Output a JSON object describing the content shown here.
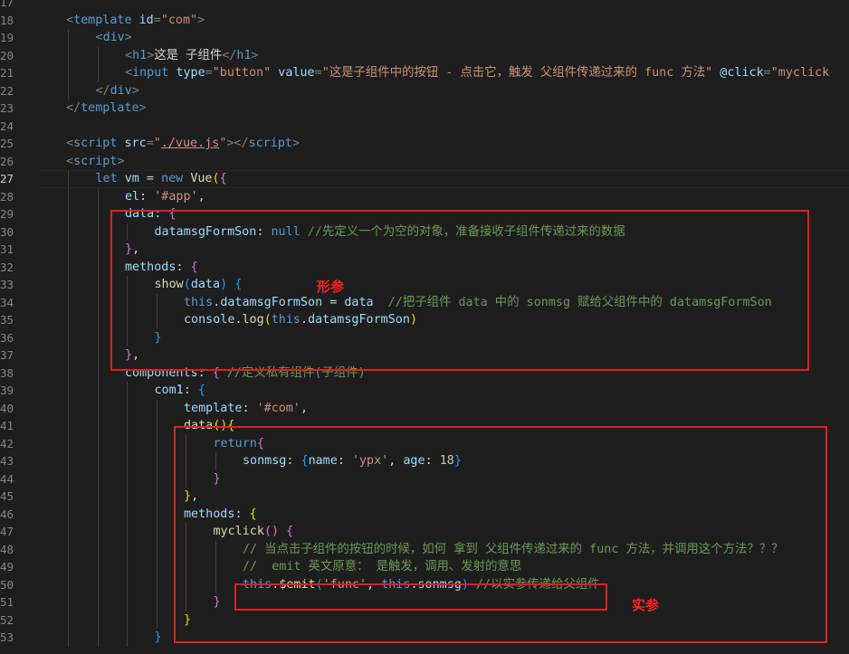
{
  "editor": {
    "colors": {
      "background": "#1e1e1e",
      "tag": "#569cd6",
      "attr": "#9cdcfe",
      "string": "#ce9178",
      "keyword": "#c586c0",
      "function": "#dcdcaa",
      "comment": "#6a9955",
      "text": "#d4d4d4",
      "annotation": "#e0201f"
    },
    "active_line": 27,
    "lines": [
      {
        "n": 17,
        "i": 0,
        "t": []
      },
      {
        "n": 18,
        "i": 1,
        "t": [
          [
            "p",
            "<"
          ],
          [
            "tg",
            "template"
          ],
          [
            "a",
            " id"
          ],
          [
            "p",
            "="
          ],
          [
            "s",
            "\"com\""
          ],
          [
            "p",
            ">"
          ]
        ]
      },
      {
        "n": 19,
        "i": 2,
        "t": [
          [
            "p",
            "<"
          ],
          [
            "tg",
            "div"
          ],
          [
            "p",
            ">"
          ]
        ]
      },
      {
        "n": 20,
        "i": 3,
        "t": [
          [
            "p",
            "<"
          ],
          [
            "tg",
            "h1"
          ],
          [
            "p",
            ">"
          ],
          [
            "tx",
            "这是 子组件"
          ],
          [
            "p",
            "</"
          ],
          [
            "tg",
            "h1"
          ],
          [
            "p",
            ">"
          ]
        ]
      },
      {
        "n": 21,
        "i": 3,
        "t": [
          [
            "p",
            "<"
          ],
          [
            "tg",
            "input"
          ],
          [
            "a",
            " type"
          ],
          [
            "p",
            "="
          ],
          [
            "s",
            "\"button\""
          ],
          [
            "a",
            " value"
          ],
          [
            "p",
            "="
          ],
          [
            "s",
            "\"这是子组件中的按钮 - 点击它，触发 父组件传递过来的 func 方法\""
          ],
          [
            "a",
            " @click"
          ],
          [
            "p",
            "="
          ],
          [
            "s",
            "\"myclick"
          ]
        ]
      },
      {
        "n": 22,
        "i": 2,
        "t": [
          [
            "p",
            "</"
          ],
          [
            "tg",
            "div"
          ],
          [
            "p",
            ">"
          ]
        ]
      },
      {
        "n": 23,
        "i": 1,
        "t": [
          [
            "p",
            "</"
          ],
          [
            "tg",
            "template"
          ],
          [
            "p",
            ">"
          ]
        ]
      },
      {
        "n": 24,
        "i": 0,
        "t": []
      },
      {
        "n": 25,
        "i": 1,
        "t": [
          [
            "p",
            "<"
          ],
          [
            "tg",
            "script"
          ],
          [
            "a",
            " src"
          ],
          [
            "p",
            "="
          ],
          [
            "s",
            "\""
          ],
          [
            "su",
            "./vue.js"
          ],
          [
            "s",
            "\""
          ],
          [
            "p",
            "></"
          ],
          [
            "tg",
            "script"
          ],
          [
            "p",
            ">"
          ]
        ]
      },
      {
        "n": 26,
        "i": 1,
        "t": [
          [
            "p",
            "<"
          ],
          [
            "tg",
            "script"
          ],
          [
            "p",
            ">"
          ]
        ]
      },
      {
        "n": 27,
        "i": 2,
        "t": [
          [
            "k",
            "let"
          ],
          [
            "tx",
            " "
          ],
          [
            "v",
            "vm"
          ],
          [
            "tx",
            " = "
          ],
          [
            "k",
            "new"
          ],
          [
            "tx",
            " "
          ],
          [
            "f",
            "Vue"
          ],
          [
            "b1",
            "("
          ],
          [
            "b2",
            "{"
          ]
        ]
      },
      {
        "n": 28,
        "i": 3,
        "t": [
          [
            "v",
            "el"
          ],
          [
            "tx",
            ": "
          ],
          [
            "s",
            "'#app'"
          ],
          [
            "tx",
            ","
          ]
        ]
      },
      {
        "n": 29,
        "i": 3,
        "t": [
          [
            "v",
            "data"
          ],
          [
            "tx",
            ": "
          ],
          [
            "b2",
            "{"
          ]
        ]
      },
      {
        "n": 30,
        "i": 4,
        "t": [
          [
            "v",
            "datamsgFormSon"
          ],
          [
            "tx",
            ": "
          ],
          [
            "k",
            "null"
          ],
          [
            "tx",
            " "
          ],
          [
            "c",
            "//先定义一个为空的对象，准备接收子组件传递过来的数据"
          ]
        ]
      },
      {
        "n": 31,
        "i": 3,
        "t": [
          [
            "b2",
            "}"
          ],
          [
            "tx",
            ","
          ]
        ]
      },
      {
        "n": 32,
        "i": 3,
        "t": [
          [
            "v",
            "methods"
          ],
          [
            "tx",
            ": "
          ],
          [
            "b2",
            "{"
          ]
        ]
      },
      {
        "n": 33,
        "i": 4,
        "t": [
          [
            "f",
            "show"
          ],
          [
            "b3",
            "("
          ],
          [
            "v",
            "data"
          ],
          [
            "b3",
            ")"
          ],
          [
            "tx",
            " "
          ],
          [
            "b3",
            "{"
          ]
        ]
      },
      {
        "n": 34,
        "i": 5,
        "t": [
          [
            "k",
            "this"
          ],
          [
            "tx",
            "."
          ],
          [
            "v",
            "datamsgFormSon"
          ],
          [
            "tx",
            " = "
          ],
          [
            "v",
            "data"
          ],
          [
            "tx",
            "  "
          ],
          [
            "c",
            "//把子组件 data 中的 sonmsg 赋给父组件中的 datamsgFormSon"
          ]
        ]
      },
      {
        "n": 35,
        "i": 5,
        "t": [
          [
            "v",
            "console"
          ],
          [
            "tx",
            "."
          ],
          [
            "f",
            "log"
          ],
          [
            "b1",
            "("
          ],
          [
            "k",
            "this"
          ],
          [
            "tx",
            "."
          ],
          [
            "v",
            "datamsgFormSon"
          ],
          [
            "b1",
            ")"
          ]
        ]
      },
      {
        "n": 36,
        "i": 4,
        "t": [
          [
            "b3",
            "}"
          ]
        ]
      },
      {
        "n": 37,
        "i": 3,
        "t": [
          [
            "b2",
            "}"
          ],
          [
            "tx",
            ","
          ]
        ]
      },
      {
        "n": 38,
        "i": 3,
        "t": [
          [
            "v",
            "components"
          ],
          [
            "tx",
            ": "
          ],
          [
            "b2",
            "{"
          ],
          [
            "tx",
            " "
          ],
          [
            "c",
            "//定义私有组件(子组件)"
          ]
        ]
      },
      {
        "n": 39,
        "i": 4,
        "t": [
          [
            "v",
            "com1"
          ],
          [
            "tx",
            ": "
          ],
          [
            "b3",
            "{"
          ]
        ]
      },
      {
        "n": 40,
        "i": 5,
        "t": [
          [
            "v",
            "template"
          ],
          [
            "tx",
            ": "
          ],
          [
            "s",
            "'#com'"
          ],
          [
            "tx",
            ","
          ]
        ]
      },
      {
        "n": 41,
        "i": 5,
        "t": [
          [
            "f",
            "data"
          ],
          [
            "b1",
            "(){"
          ]
        ]
      },
      {
        "n": 42,
        "i": 6,
        "t": [
          [
            "k",
            "return"
          ],
          [
            "b2",
            "{"
          ]
        ]
      },
      {
        "n": 43,
        "i": 7,
        "t": [
          [
            "v",
            "sonmsg"
          ],
          [
            "tx",
            ": "
          ],
          [
            "b3",
            "{"
          ],
          [
            "v",
            "name"
          ],
          [
            "tx",
            ": "
          ],
          [
            "s",
            "'ypx'"
          ],
          [
            "tx",
            ", "
          ],
          [
            "v",
            "age"
          ],
          [
            "tx",
            ": "
          ],
          [
            "n",
            "18"
          ],
          [
            "b3",
            "}"
          ]
        ]
      },
      {
        "n": 44,
        "i": 6,
        "t": [
          [
            "b2",
            "}"
          ]
        ]
      },
      {
        "n": 45,
        "i": 5,
        "t": [
          [
            "b1",
            "}"
          ],
          [
            "tx",
            ","
          ]
        ]
      },
      {
        "n": 46,
        "i": 5,
        "t": [
          [
            "v",
            "methods"
          ],
          [
            "tx",
            ": "
          ],
          [
            "b1",
            "{"
          ]
        ]
      },
      {
        "n": 47,
        "i": 6,
        "t": [
          [
            "f",
            "myclick"
          ],
          [
            "b2",
            "()"
          ],
          [
            "tx",
            " "
          ],
          [
            "b2",
            "{"
          ]
        ]
      },
      {
        "n": 48,
        "i": 7,
        "t": [
          [
            "c",
            "// 当点击子组件的按钮的时候，如何 拿到 父组件传递过来的 func 方法，并调用这个方法？？？"
          ]
        ]
      },
      {
        "n": 49,
        "i": 7,
        "t": [
          [
            "c",
            "//  emit 英文原意： 是触发，调用、发射的意思"
          ]
        ]
      },
      {
        "n": 50,
        "i": 7,
        "t": [
          [
            "k",
            "this"
          ],
          [
            "tx",
            "."
          ],
          [
            "f",
            "$emit"
          ],
          [
            "b3",
            "("
          ],
          [
            "s",
            "'func'"
          ],
          [
            "tx",
            ", "
          ],
          [
            "k",
            "this"
          ],
          [
            "tx",
            "."
          ],
          [
            "v",
            "sonmsg"
          ],
          [
            "b3",
            ")"
          ],
          [
            "tx",
            " "
          ],
          [
            "c",
            "//以实参传递给父组件"
          ]
        ]
      },
      {
        "n": 51,
        "i": 6,
        "t": [
          [
            "b2",
            "}"
          ]
        ]
      },
      {
        "n": 52,
        "i": 5,
        "t": [
          [
            "b1",
            "}"
          ]
        ]
      },
      {
        "n": 53,
        "i": 4,
        "t": [
          [
            "b3",
            "}"
          ]
        ]
      }
    ]
  },
  "annotations": {
    "formal_param": "形参",
    "actual_param": "实参"
  }
}
